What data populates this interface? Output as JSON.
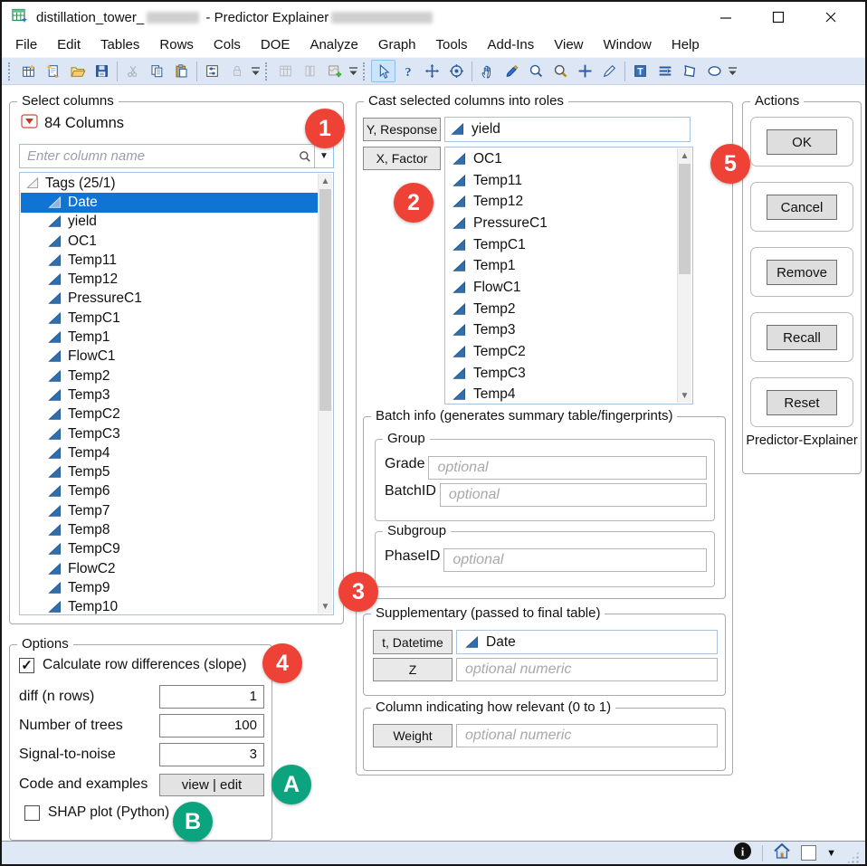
{
  "window": {
    "title_prefix": "distillation_tower_",
    "title_mid": " - Predictor Explainer",
    "controls": {
      "minimize": "minimize",
      "maximize": "maximize",
      "close": "close"
    }
  },
  "menu": {
    "items": [
      "File",
      "Edit",
      "Tables",
      "Rows",
      "Cols",
      "DOE",
      "Analyze",
      "Graph",
      "Tools",
      "Add-Ins",
      "View",
      "Window",
      "Help"
    ]
  },
  "toolbar": {
    "items": [
      {
        "type": "grip"
      },
      {
        "type": "icon",
        "name": "new-data-table-icon"
      },
      {
        "type": "icon",
        "name": "new-script-icon"
      },
      {
        "type": "icon",
        "name": "open-file-icon"
      },
      {
        "type": "icon",
        "name": "save-icon"
      },
      {
        "type": "sep"
      },
      {
        "type": "icon",
        "name": "cut-icon",
        "state": "disabled"
      },
      {
        "type": "icon",
        "name": "copy-icon"
      },
      {
        "type": "icon",
        "name": "paste-icon"
      },
      {
        "type": "sep"
      },
      {
        "type": "icon",
        "name": "preferences-icon"
      },
      {
        "type": "icon",
        "name": "lock-icon",
        "state": "disabled"
      },
      {
        "type": "drop"
      },
      {
        "type": "grip"
      },
      {
        "type": "icon",
        "name": "data-table-icon",
        "state": "disabled"
      },
      {
        "type": "icon",
        "name": "columns-icon",
        "state": "disabled"
      },
      {
        "type": "icon",
        "name": "map-add-icon"
      },
      {
        "type": "drop"
      },
      {
        "type": "grip"
      },
      {
        "type": "icon",
        "name": "cursor-icon",
        "state": "active"
      },
      {
        "type": "icon",
        "name": "help-icon"
      },
      {
        "type": "icon",
        "name": "move-icon"
      },
      {
        "type": "icon",
        "name": "bullseye-icon"
      },
      {
        "type": "sep"
      },
      {
        "type": "icon",
        "name": "hand-icon"
      },
      {
        "type": "icon",
        "name": "brush-icon"
      },
      {
        "type": "icon",
        "name": "lasso-zoom-icon"
      },
      {
        "type": "icon",
        "name": "magnifier-icon"
      },
      {
        "type": "icon",
        "name": "crosshair-icon"
      },
      {
        "type": "icon",
        "name": "scalpel-icon"
      },
      {
        "type": "sep"
      },
      {
        "type": "icon",
        "name": "text-annotation-icon"
      },
      {
        "type": "icon",
        "name": "lines-annotation-icon"
      },
      {
        "type": "icon",
        "name": "polygon-annotation-icon"
      },
      {
        "type": "icon",
        "name": "oval-annotation-icon"
      },
      {
        "type": "drop"
      }
    ]
  },
  "select_columns": {
    "label": "Select columns",
    "count_label": "84 Columns",
    "search": {
      "placeholder": "Enter column name"
    },
    "tree": {
      "header": "Tags (25/1)",
      "items": [
        {
          "label": "Date",
          "selected": true
        },
        {
          "label": "yield"
        },
        {
          "label": "OC1"
        },
        {
          "label": "Temp11"
        },
        {
          "label": "Temp12"
        },
        {
          "label": "PressureC1"
        },
        {
          "label": "TempC1"
        },
        {
          "label": "Temp1"
        },
        {
          "label": "FlowC1"
        },
        {
          "label": "Temp2"
        },
        {
          "label": "Temp3"
        },
        {
          "label": "TempC2"
        },
        {
          "label": "TempC3"
        },
        {
          "label": "Temp4"
        },
        {
          "label": "Temp5"
        },
        {
          "label": "Temp6"
        },
        {
          "label": "Temp7"
        },
        {
          "label": "Temp8"
        },
        {
          "label": "TempC9"
        },
        {
          "label": "FlowC2"
        },
        {
          "label": "Temp9"
        },
        {
          "label": "Temp10"
        }
      ]
    }
  },
  "cast": {
    "label": "Cast selected columns into roles",
    "y_role": {
      "button": "Y, Response",
      "value": "yield"
    },
    "x_role": {
      "button": "X, Factor",
      "items": [
        "OC1",
        "Temp11",
        "Temp12",
        "PressureC1",
        "TempC1",
        "Temp1",
        "FlowC1",
        "Temp2",
        "Temp3",
        "TempC2",
        "TempC3",
        "Temp4"
      ]
    },
    "batch": {
      "label": "Batch info (generates summary table/fingerprints)",
      "group": {
        "label": "Group",
        "rows": [
          {
            "button": "Grade",
            "placeholder": "optional"
          },
          {
            "button": "BatchID",
            "placeholder": "optional"
          }
        ]
      },
      "subgroup": {
        "label": "Subgroup",
        "rows": [
          {
            "button": "PhaseID",
            "placeholder": "optional"
          }
        ]
      }
    },
    "supplementary": {
      "label": "Supplementary (passed to final table)",
      "datetime": {
        "button": "t, Datetime",
        "value": "Date"
      },
      "z": {
        "button": "Z",
        "placeholder": "optional numeric"
      }
    },
    "relevance": {
      "label": "Column indicating how relevant (0 to 1)",
      "weight": {
        "button": "Weight",
        "placeholder": "optional numeric"
      }
    }
  },
  "actions": {
    "label": "Actions",
    "buttons": [
      "OK",
      "Cancel",
      "Remove",
      "Recall",
      "Reset"
    ],
    "caption": "Predictor-Explainer"
  },
  "options": {
    "label": "Options",
    "row_diff": {
      "label": "Calculate row differences (slope)",
      "checked": true,
      "check_glyph": "✓"
    },
    "numeric_rows": [
      {
        "label": "diff (n rows)",
        "value": "1"
      },
      {
        "label": "Number of trees",
        "value": "100"
      },
      {
        "label": "Signal-to-noise",
        "value": "3"
      }
    ],
    "code": {
      "label": "Code and examples",
      "button": "view | edit"
    },
    "shap": {
      "label": "SHAP plot (Python)",
      "checked": false
    }
  },
  "badges": {
    "items": [
      {
        "label": "1"
      },
      {
        "label": "2"
      },
      {
        "label": "3"
      },
      {
        "label": "4"
      },
      {
        "label": "5"
      },
      {
        "label": "A"
      },
      {
        "label": "B"
      }
    ],
    "red": "#ee4237",
    "green": "#0ba47e"
  },
  "colors": {
    "selection": "#0f74d4",
    "toolbar_bg": "#dce6f5",
    "status_bg": "#dfe8f5",
    "continuous_icon": "#2f6fae"
  }
}
